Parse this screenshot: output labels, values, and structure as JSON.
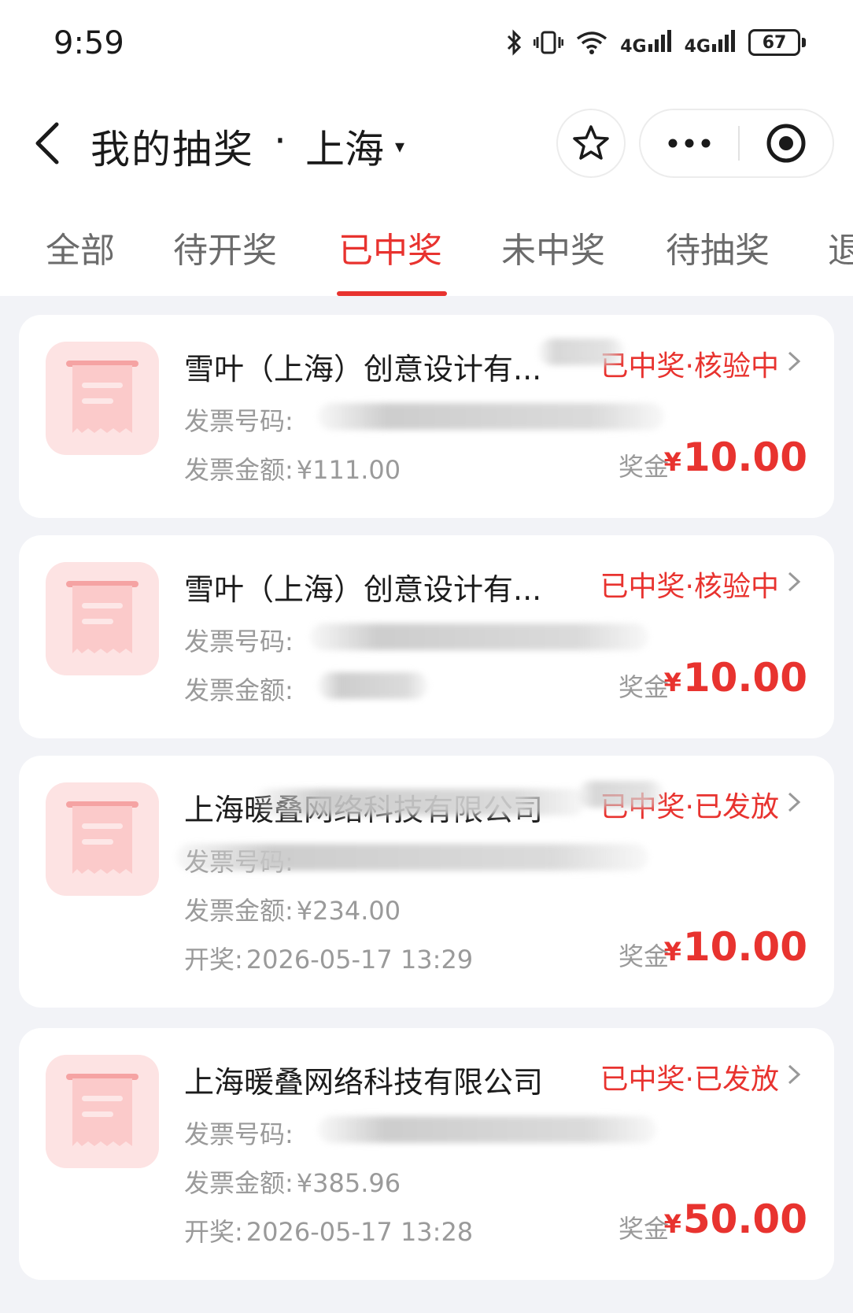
{
  "status_bar": {
    "time": "9:59",
    "battery": "67",
    "icons": [
      "bluetooth-icon",
      "vibrate-icon",
      "wifi-icon",
      "4g-signal-icon",
      "4g-signal-icon"
    ],
    "net1": "4G",
    "net2": "4G"
  },
  "header": {
    "title": "我的抽奖",
    "separator": "·",
    "city": "上海",
    "caret": "▾"
  },
  "tabs": [
    {
      "label": "全部"
    },
    {
      "label": "待开奖"
    },
    {
      "label": "已中奖"
    },
    {
      "label": "未中奖"
    },
    {
      "label": "待抽奖"
    },
    {
      "label": "退"
    }
  ],
  "active_tab": "已中奖",
  "colors": {
    "accent": "#e8332f",
    "background": "#f2f3f7",
    "thumb": "#fde3e3"
  },
  "labels": {
    "invoice_no": "发票号码:",
    "invoice_amount": "发票金额:",
    "draw": "开奖:",
    "bonus": "奖金",
    "currency": "¥"
  },
  "records": [
    {
      "company": "雪叶（上海）创意设计有...",
      "status": "已中奖·核验中",
      "invoice_no": "",
      "invoice_amount": "¥111.00",
      "draw_time": "",
      "bonus": "10.00"
    },
    {
      "company": "雪叶（上海）创意设计有...",
      "status": "已中奖·核验中",
      "invoice_no": "",
      "invoice_amount": "",
      "draw_time": "",
      "bonus": "10.00"
    },
    {
      "company": "上海暖叠网络科技有限公司",
      "status": "已中奖·已发放",
      "invoice_no": "",
      "invoice_amount": "¥234.00",
      "draw_time": "2026-05-17 13:29",
      "bonus": "10.00"
    },
    {
      "company": "上海暖叠网络科技有限公司",
      "status": "已中奖·已发放",
      "invoice_no": "",
      "invoice_amount": "¥385.96",
      "draw_time": "2026-05-17 13:28",
      "bonus": "50.00"
    }
  ]
}
